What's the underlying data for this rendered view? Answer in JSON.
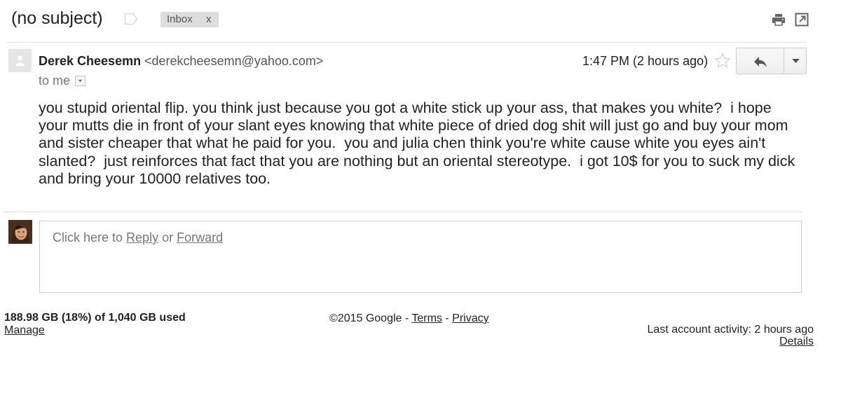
{
  "header": {
    "subject": "(no subject)",
    "label": "Inbox",
    "label_remove": "x"
  },
  "sender": {
    "name": "Derek Cheesemn",
    "email": "<derekcheesemn@yahoo.com>",
    "to": "to me",
    "time": "1:47 PM (2 hours ago)"
  },
  "message": {
    "body": "you stupid oriental flip. you think just because you got a white stick up your ass, that makes you white?  i hope your mutts die in front of your slant eyes knowing that white piece of dried dog shit will just go and buy your mom and sister cheaper that what he paid for you.  you and julia chen think you're white cause white you eyes ain't slanted?  just reinforces that fact that you are nothing but an oriental stereotype.  i got 10$ for you to suck my dick and bring your 10000 relatives too."
  },
  "reply_box": {
    "prefix": "Click here to ",
    "reply_link": "Reply",
    "middle": " or ",
    "forward_link": "Forward"
  },
  "footer": {
    "storage": "188.98 GB (18%) of 1,040 GB used",
    "manage": "Manage",
    "copyright": "©2015 Google - ",
    "terms": "Terms",
    "sep": " - ",
    "privacy": "Privacy",
    "last_activity": "Last account activity: 2 hours ago",
    "details": "Details"
  },
  "icons": {
    "label": "label-tag-icon",
    "print": "print-icon",
    "popout": "popout-icon",
    "star": "star-icon",
    "reply": "reply-arrow-icon",
    "more": "chevron-down-icon"
  }
}
